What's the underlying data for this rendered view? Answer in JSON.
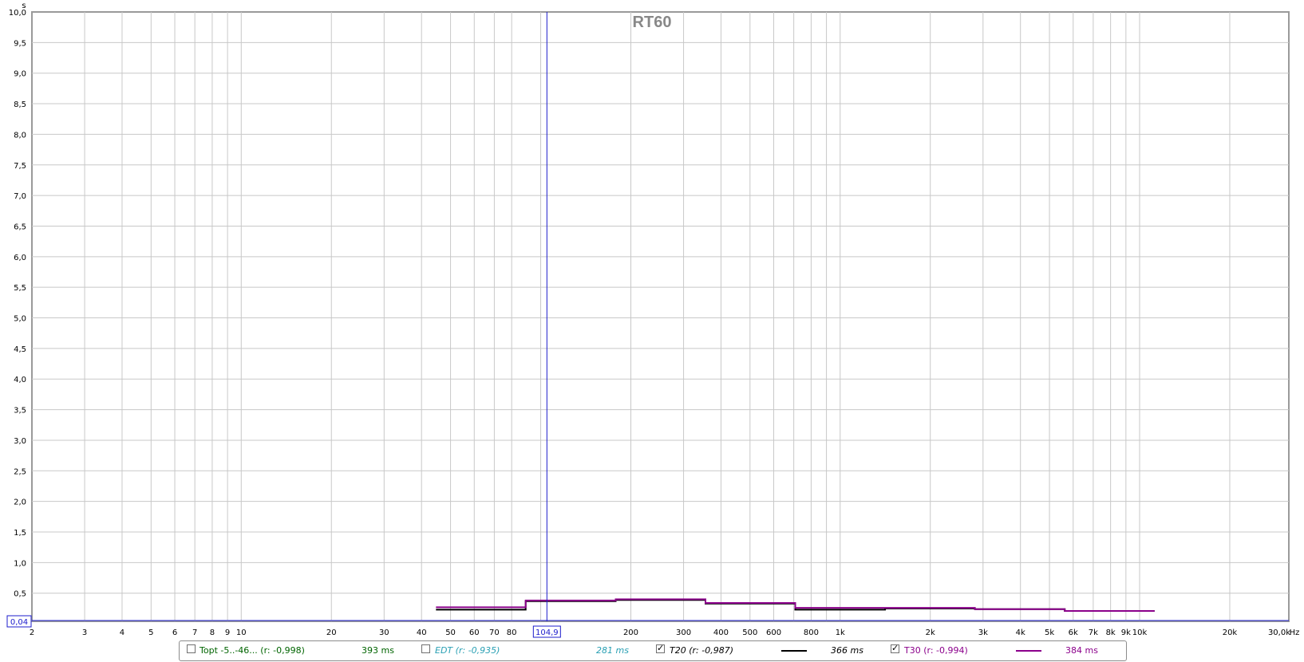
{
  "chart_data": {
    "type": "line",
    "title": "RT60",
    "x_unit": "Hz",
    "y_unit": "s",
    "x_scale": "log",
    "xlim": [
      2,
      31500
    ],
    "ylim": [
      0.04,
      10.0
    ],
    "grid": true,
    "x_ticks": [
      {
        "v": 2,
        "label": "2"
      },
      {
        "v": 3,
        "label": "3"
      },
      {
        "v": 4,
        "label": "4"
      },
      {
        "v": 5,
        "label": "5"
      },
      {
        "v": 6,
        "label": "6"
      },
      {
        "v": 7,
        "label": "7"
      },
      {
        "v": 8,
        "label": "8"
      },
      {
        "v": 9,
        "label": "9"
      },
      {
        "v": 10,
        "label": "10"
      },
      {
        "v": 20,
        "label": "20"
      },
      {
        "v": 30,
        "label": "30"
      },
      {
        "v": 40,
        "label": "40"
      },
      {
        "v": 50,
        "label": "50"
      },
      {
        "v": 60,
        "label": "60"
      },
      {
        "v": 70,
        "label": "70"
      },
      {
        "v": 80,
        "label": "80"
      },
      {
        "v": 200,
        "label": "200"
      },
      {
        "v": 300,
        "label": "300"
      },
      {
        "v": 400,
        "label": "400"
      },
      {
        "v": 500,
        "label": "500"
      },
      {
        "v": 600,
        "label": "600"
      },
      {
        "v": 800,
        "label": "800"
      },
      {
        "v": 1000,
        "label": "1k"
      },
      {
        "v": 2000,
        "label": "2k"
      },
      {
        "v": 3000,
        "label": "3k"
      },
      {
        "v": 4000,
        "label": "4k"
      },
      {
        "v": 5000,
        "label": "5k"
      },
      {
        "v": 6000,
        "label": "6k"
      },
      {
        "v": 7000,
        "label": "7k"
      },
      {
        "v": 8000,
        "label": "8k"
      },
      {
        "v": 9000,
        "label": "9k"
      },
      {
        "v": 10000,
        "label": "10k"
      },
      {
        "v": 20000,
        "label": "20k"
      },
      {
        "v": 31500,
        "label": "30,0k"
      }
    ],
    "x_minor_grid": [
      100,
      700,
      900
    ],
    "y_ticks": [
      "10,0",
      "9,5",
      "9,0",
      "8,5",
      "8,0",
      "7,5",
      "7,0",
      "6,5",
      "6,0",
      "5,5",
      "5,0",
      "4,5",
      "4,0",
      "3,5",
      "3,0",
      "2,5",
      "2,0",
      "1,5",
      "1,0",
      "0,5"
    ],
    "y_tick_values": [
      10,
      9.5,
      9,
      8.5,
      8,
      7.5,
      7,
      6.5,
      6,
      5.5,
      5,
      4.5,
      4,
      3.5,
      3,
      2.5,
      2,
      1.5,
      1,
      0.5
    ],
    "cursor": {
      "x": 104.9,
      "x_label": "104,9",
      "y_label": "0,04"
    },
    "series": [
      {
        "name": "T20 (r: -0,987)",
        "color": "#000000",
        "bands": [
          {
            "f1": 44.7,
            "f2": 89.1,
            "v": 0.23
          },
          {
            "f1": 89.1,
            "f2": 178,
            "v": 0.37
          },
          {
            "f1": 178,
            "f2": 355,
            "v": 0.39
          },
          {
            "f1": 355,
            "f2": 708,
            "v": 0.33
          },
          {
            "f1": 708,
            "f2": 1413,
            "v": 0.23
          },
          {
            "f1": 1413,
            "f2": 2818,
            "v": 0.25
          },
          {
            "f1": 2818,
            "f2": 5623,
            "v": 0.24
          },
          {
            "f1": 5623,
            "f2": 11220,
            "v": 0.21
          }
        ]
      },
      {
        "name": "T30 (r: -0,994)",
        "color": "#8b008b",
        "bands": [
          {
            "f1": 44.7,
            "f2": 89.1,
            "v": 0.27
          },
          {
            "f1": 89.1,
            "f2": 178,
            "v": 0.38
          },
          {
            "f1": 178,
            "f2": 355,
            "v": 0.4
          },
          {
            "f1": 355,
            "f2": 708,
            "v": 0.34
          },
          {
            "f1": 708,
            "f2": 1413,
            "v": 0.26
          },
          {
            "f1": 1413,
            "f2": 2818,
            "v": 0.26
          },
          {
            "f1": 2818,
            "f2": 5623,
            "v": 0.24
          },
          {
            "f1": 5623,
            "f2": 11220,
            "v": 0.21
          }
        ]
      }
    ]
  },
  "legend": {
    "items": [
      {
        "label": "Topt -5..-46... (r: -0,998)",
        "value": "393 ms",
        "checked": false,
        "color": "#006400",
        "italic": false
      },
      {
        "label": "EDT (r: -0,935)",
        "value": "281 ms",
        "checked": false,
        "color": "#2aa0b4",
        "italic": true
      },
      {
        "label": "T20 (r: -0,987)",
        "value": "366 ms",
        "checked": true,
        "color": "#000000",
        "italic": true
      },
      {
        "label": "T30 (r: -0,994)",
        "value": "384 ms",
        "checked": true,
        "color": "#8b008b",
        "italic": false
      }
    ]
  }
}
